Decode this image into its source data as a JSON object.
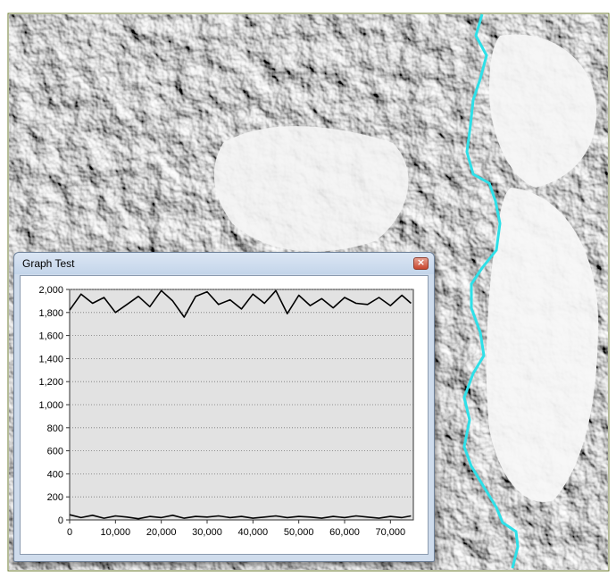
{
  "window": {
    "title": "Graph Test",
    "close_glyph": "×"
  },
  "icons": {
    "close": "close-icon"
  },
  "colors": {
    "river": "#2ee0e8",
    "plot_background": "#e2e2e2",
    "series_line": "#000000"
  },
  "chart_data": {
    "type": "line",
    "title": "",
    "xlabel": "",
    "ylabel": "",
    "xlim": [
      0,
      75000
    ],
    "ylim": [
      0,
      2000
    ],
    "grid": true,
    "x_ticks": [
      "0",
      "10,000",
      "20,000",
      "30,000",
      "40,000",
      "50,000",
      "60,000",
      "70,000"
    ],
    "x_tick_values": [
      0,
      10000,
      20000,
      30000,
      40000,
      50000,
      60000,
      70000
    ],
    "y_ticks": [
      "0",
      "200",
      "400",
      "600",
      "800",
      "1,000",
      "1,200",
      "1,400",
      "1,600",
      "1,800",
      "2,000"
    ],
    "y_tick_values": [
      0,
      200,
      400,
      600,
      800,
      1000,
      1200,
      1400,
      1600,
      1800,
      2000
    ],
    "series": [
      {
        "x": [
          0,
          2500,
          5000,
          7500,
          10000,
          12500,
          15000,
          17500,
          20000,
          22500,
          25000,
          27500,
          30000,
          32500,
          35000,
          37500,
          40000,
          42500,
          45000,
          47500,
          50000,
          52500,
          55000,
          57500,
          60000,
          62500,
          65000,
          67500,
          70000,
          72500,
          74500
        ],
        "values": [
          1820,
          1960,
          1880,
          1930,
          1800,
          1870,
          1940,
          1850,
          1990,
          1900,
          1760,
          1940,
          1980,
          1870,
          1910,
          1830,
          1960,
          1880,
          1990,
          1790,
          1950,
          1860,
          1920,
          1840,
          1930,
          1880,
          1870,
          1930,
          1860,
          1950,
          1880
        ]
      },
      {
        "x": [
          0,
          2500,
          5000,
          7500,
          10000,
          12500,
          15000,
          17500,
          20000,
          22500,
          25000,
          27500,
          30000,
          32500,
          35000,
          37500,
          40000,
          42500,
          45000,
          47500,
          50000,
          52500,
          55000,
          57500,
          60000,
          62500,
          65000,
          67500,
          70000,
          72500,
          74500
        ],
        "values": [
          45,
          20,
          40,
          15,
          35,
          25,
          10,
          30,
          20,
          40,
          15,
          30,
          25,
          35,
          20,
          30,
          15,
          25,
          35,
          20,
          30,
          25,
          15,
          30,
          20,
          35,
          25,
          15,
          30,
          20,
          35
        ]
      }
    ]
  }
}
